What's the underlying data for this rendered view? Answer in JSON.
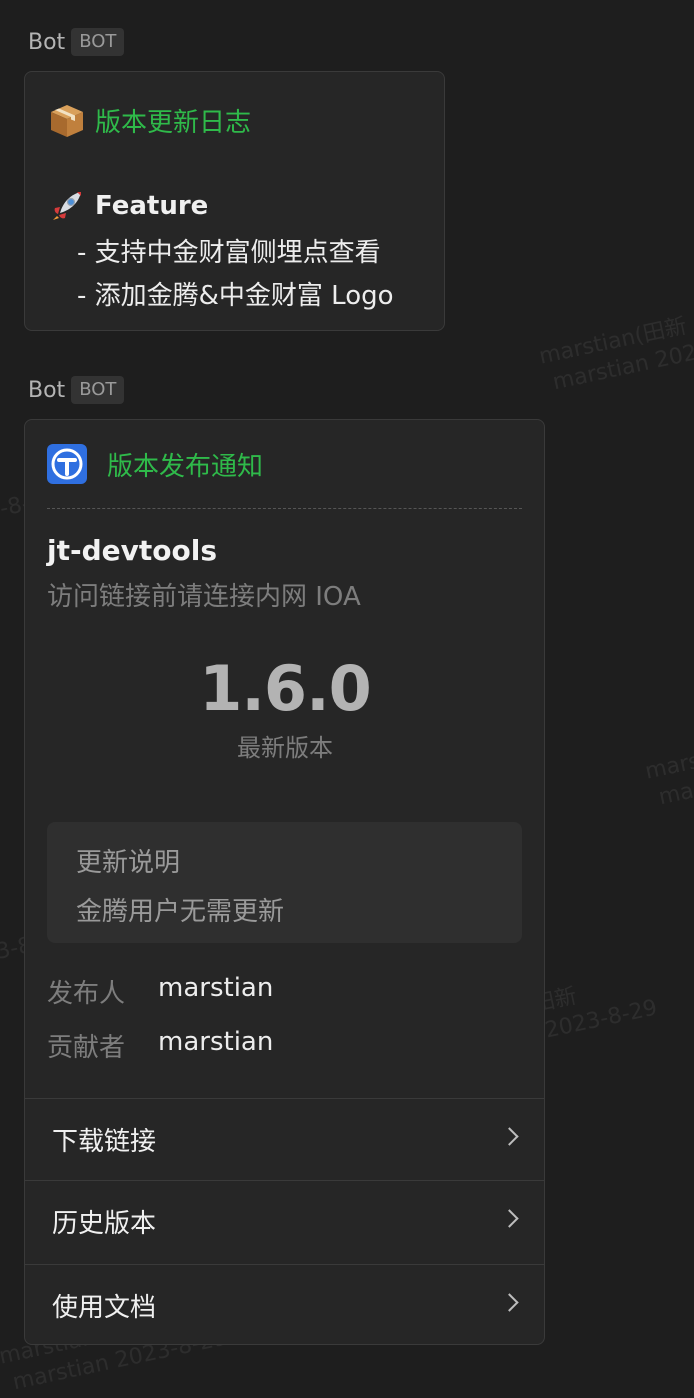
{
  "watermark": {
    "name": "marstian(田新",
    "date": "marstian 2023-8-29"
  },
  "messages": [
    {
      "sender": "Bot",
      "tag": "BOT",
      "changelog": {
        "icon": "package-icon",
        "title": "版本更新日志",
        "section_icon": "rocket-icon",
        "section": "Feature",
        "items": [
          "- 支持中金财富侧埋点查看",
          "- 添加金腾&中金财富 Logo"
        ]
      }
    },
    {
      "sender": "Bot",
      "tag": "BOT",
      "release": {
        "logo_icon": "app-logo-icon",
        "title": "版本发布通知",
        "project": "jt-devtools",
        "subtitle": "访问链接前请连接内网 IOA",
        "version": "1.6.0",
        "version_label": "最新版本",
        "notes_title": "更新说明",
        "notes_body": "金腾用户无需更新",
        "publisher_label": "发布人",
        "publisher": "marstian",
        "contributor_label": "贡献者",
        "contributor": "marstian",
        "links": [
          {
            "label": "下载链接",
            "icon": "chevron-right-icon"
          },
          {
            "label": "历史版本",
            "icon": "chevron-right-icon"
          },
          {
            "label": "使用文档",
            "icon": "chevron-right-icon"
          }
        ]
      }
    }
  ],
  "colors": {
    "background": "#1e1e1e",
    "card": "#262626",
    "accent_green": "#2fba4a",
    "logo_blue": "#2f6fe0"
  }
}
